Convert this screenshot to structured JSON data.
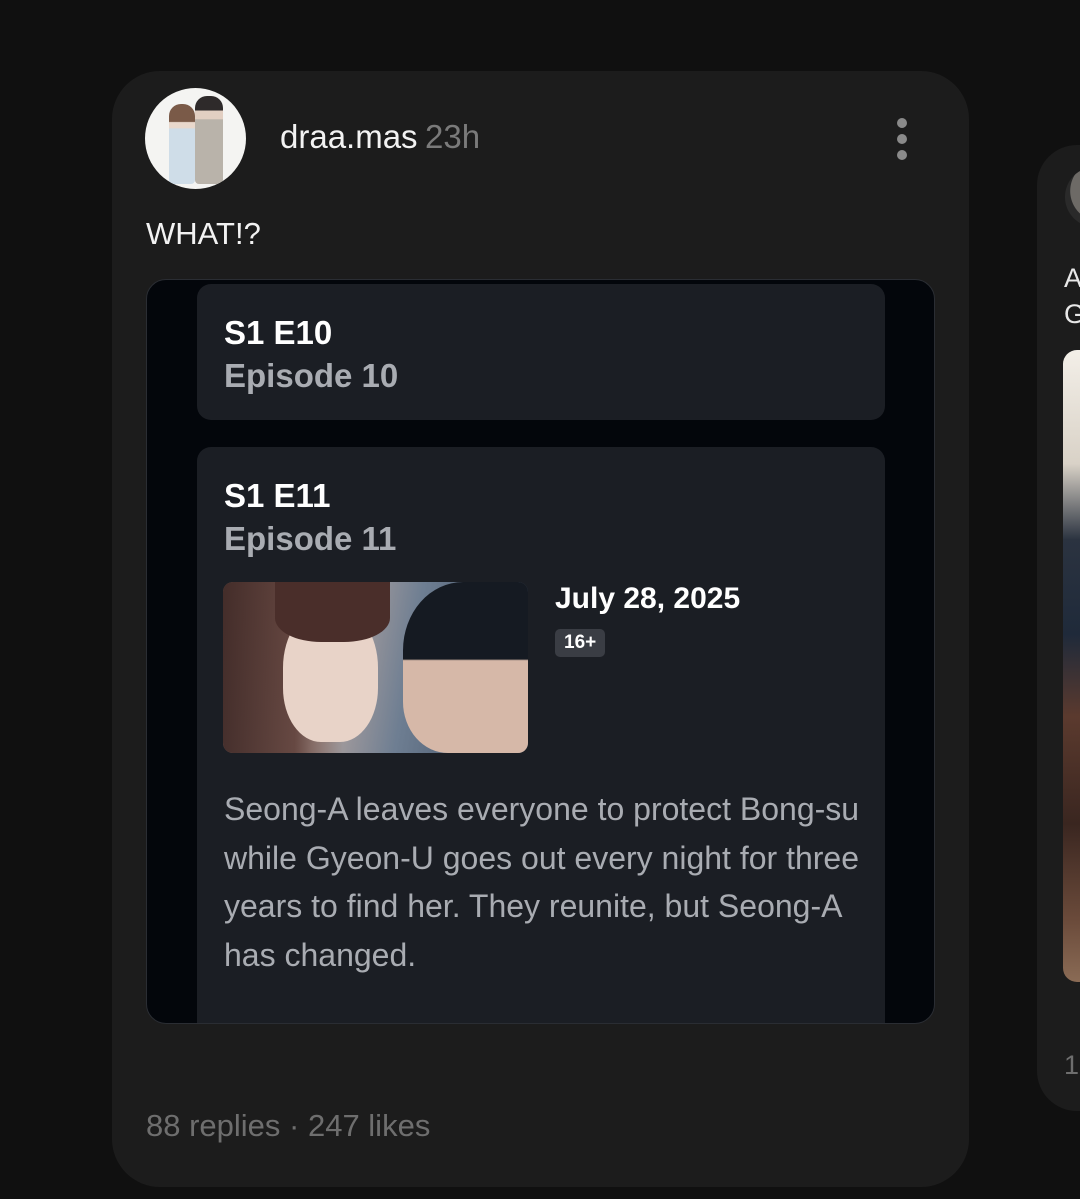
{
  "post": {
    "username": "draa.mas",
    "time": "23h",
    "caption": "WHAT!?",
    "stats": "88 replies · 247 likes"
  },
  "embed": {
    "episodes": [
      {
        "code": "S1 E10",
        "title": "Episode 10"
      },
      {
        "code": "S1 E11",
        "title": "Episode 11",
        "date": "July 28, 2025",
        "rating": "16+",
        "description": "Seong-A leaves everyone to protect Bong-su while Gyeon-U goes out every night for three years to find her. They reunite, but Seong-A has changed."
      }
    ]
  },
  "next_post": {
    "caption_line1": "A",
    "caption_line2": "G",
    "stats": "1"
  },
  "icons": [
    "more-vertical-icon"
  ]
}
